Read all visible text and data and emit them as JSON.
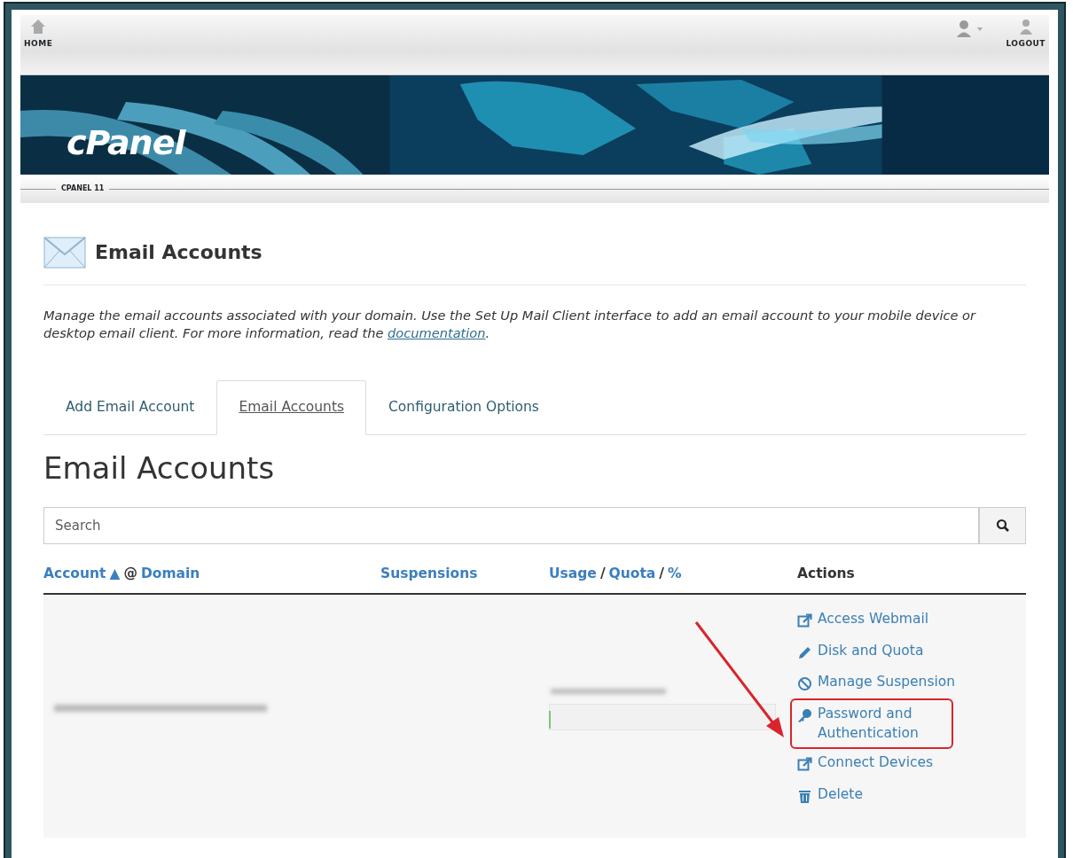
{
  "topbar": {
    "home": "HOME",
    "logout": "LOGOUT"
  },
  "banner": {
    "logo": "cPanel"
  },
  "subbar": {
    "label": "CPANEL 11"
  },
  "page": {
    "title": "Email Accounts",
    "intro": "Manage the email accounts associated with your domain. Use the Set Up Mail Client interface to add an email account to your mobile device or desktop email client. For more information, read the ",
    "intro_link": "documentation",
    "intro_end": "."
  },
  "tabs": [
    {
      "label": "Add Email Account",
      "selected": false
    },
    {
      "label": "Email Accounts",
      "selected": true
    },
    {
      "label": "Configuration Options",
      "selected": false
    }
  ],
  "section_title": "Email Accounts",
  "search": {
    "placeholder": "Search"
  },
  "columns": [
    {
      "parts": [
        {
          "text": "Account",
          "link": true
        },
        {
          "text": "▲",
          "link": true
        },
        {
          "text": "@",
          "link": false
        },
        {
          "text": "Domain",
          "link": true
        }
      ]
    },
    {
      "parts": [
        {
          "text": "Suspensions",
          "link": true
        }
      ]
    },
    {
      "parts": [
        {
          "text": "Usage",
          "link": true
        },
        {
          "text": "/",
          "link": false
        },
        {
          "text": "Quota",
          "link": true
        },
        {
          "text": "/",
          "link": false
        },
        {
          "text": "%",
          "link": true
        }
      ]
    },
    {
      "parts": [
        {
          "text": "Actions",
          "link": false
        }
      ]
    }
  ],
  "row": {
    "actions": [
      {
        "kind": "external",
        "label": "Access Webmail",
        "highlighted": false
      },
      {
        "kind": "pencil",
        "label": "Disk and Quota",
        "highlighted": false
      },
      {
        "kind": "ban",
        "label": "Manage Suspension",
        "highlighted": false
      },
      {
        "kind": "key",
        "label": "Password and Authentication",
        "highlighted": true
      },
      {
        "kind": "external",
        "label": "Connect Devices",
        "highlighted": false
      },
      {
        "kind": "trash",
        "label": "Delete",
        "highlighted": false
      }
    ]
  }
}
